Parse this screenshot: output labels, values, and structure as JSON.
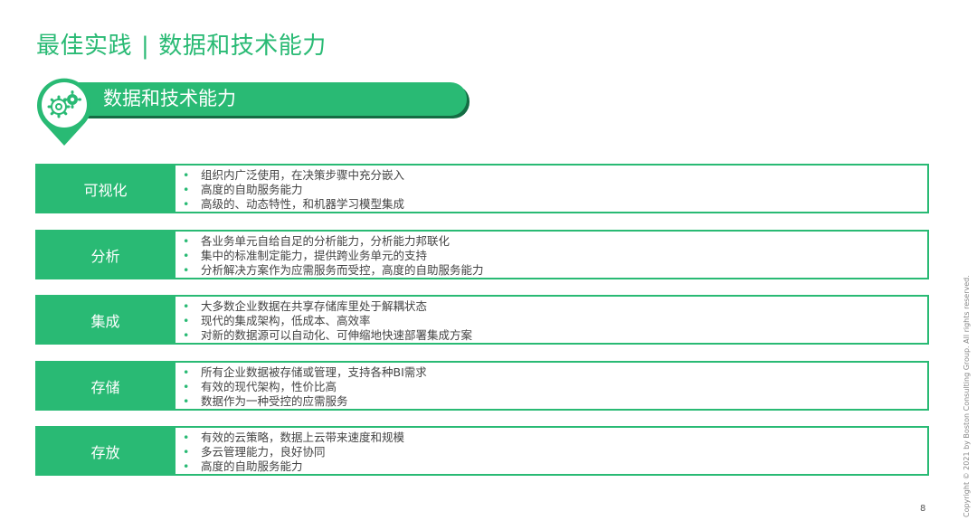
{
  "header": {
    "title_main": "最佳实践",
    "separator": "|",
    "title_sub": "数据和技术能力"
  },
  "section": {
    "label": "数据和技术能力",
    "icon": "gears-icon"
  },
  "rows": [
    {
      "label": "可视化",
      "bullets": [
        "组织内广泛使用，在决策步骤中充分嵌入",
        "高度的自助服务能力",
        "高级的、动态特性，和机器学习模型集成"
      ]
    },
    {
      "label": "分析",
      "bullets": [
        "各业务单元自给自足的分析能力，分析能力邦联化",
        "集中的标准制定能力，提供跨业务单元的支持",
        "分析解决方案作为应需服务而受控，高度的自助服务能力"
      ]
    },
    {
      "label": "集成",
      "bullets": [
        "大多数企业数据在共享存储库里处于解耦状态",
        "现代的集成架构，低成本、高效率",
        "对新的数据源可以自动化、可伸缩地快速部署集成方案"
      ]
    },
    {
      "label": "存储",
      "bullets": [
        "所有企业数据被存储或管理，支持各种BI需求",
        "有效的现代架构，性价比高",
        "数据作为一种受控的应需服务"
      ]
    },
    {
      "label": "存放",
      "bullets": [
        "有效的云策略，数据上云带来速度和规模",
        "多云管理能力，良好协同",
        "高度的自助服务能力"
      ]
    }
  ],
  "footer": {
    "copyright": "Copyright © 2021 by Boston Consulting Group. All rights reserved.",
    "page_number": "8"
  },
  "colors": {
    "accent": "#29BA74",
    "accent_dark": "#146C43"
  }
}
